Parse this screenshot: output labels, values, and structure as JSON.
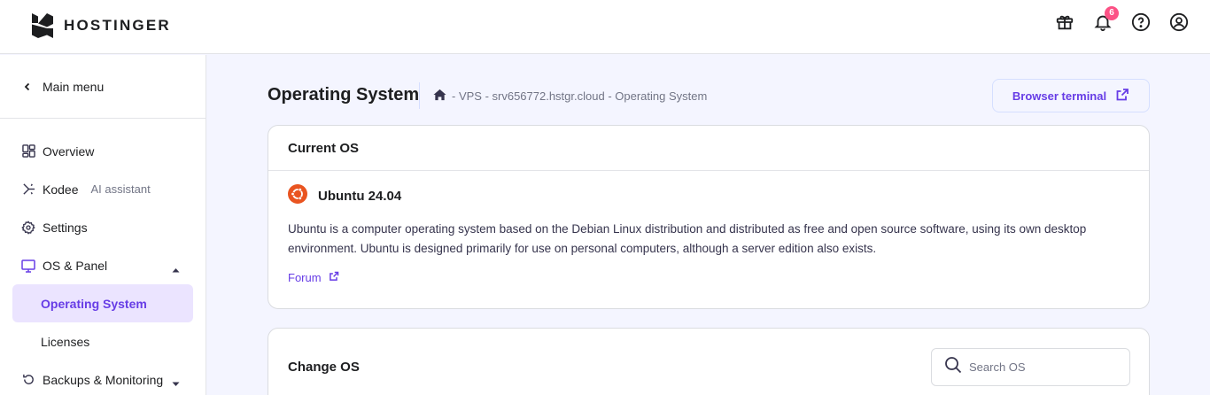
{
  "brand": {
    "name": "HOSTINGER"
  },
  "topbar": {
    "notification_count": "6"
  },
  "sidebar": {
    "main_menu": "Main menu",
    "items": [
      {
        "label": "Overview",
        "icon": "overview-icon"
      },
      {
        "label": "Kodee",
        "sublabel": "AI assistant",
        "icon": "kodee-icon"
      },
      {
        "label": "Settings",
        "icon": "gear-icon"
      },
      {
        "label": "OS & Panel",
        "icon": "monitor-icon"
      }
    ],
    "subitems": [
      {
        "label": "Operating System",
        "active": true
      },
      {
        "label": "Licenses",
        "active": false
      }
    ],
    "backups": "Backups & Monitoring"
  },
  "page": {
    "title": "Operating System",
    "breadcrumb": "- VPS - srv656772.hstgr.cloud - Operating System",
    "terminal_button": "Browser terminal"
  },
  "current_os": {
    "heading": "Current OS",
    "name": "Ubuntu 24.04",
    "description": "Ubuntu is a computer operating system based on the Debian Linux distribution and distributed as free and open source software, using its own desktop environment. Ubuntu is designed primarily for use on personal computers, although a server edition also exists.",
    "forum_link": "Forum"
  },
  "change_os": {
    "heading": "Change OS",
    "search_placeholder": "Search OS",
    "search_value": ""
  },
  "colors": {
    "accent": "#673de6",
    "active_bg": "#ebe4ff",
    "ubuntu": "#e95420",
    "badge": "#fc5185"
  }
}
